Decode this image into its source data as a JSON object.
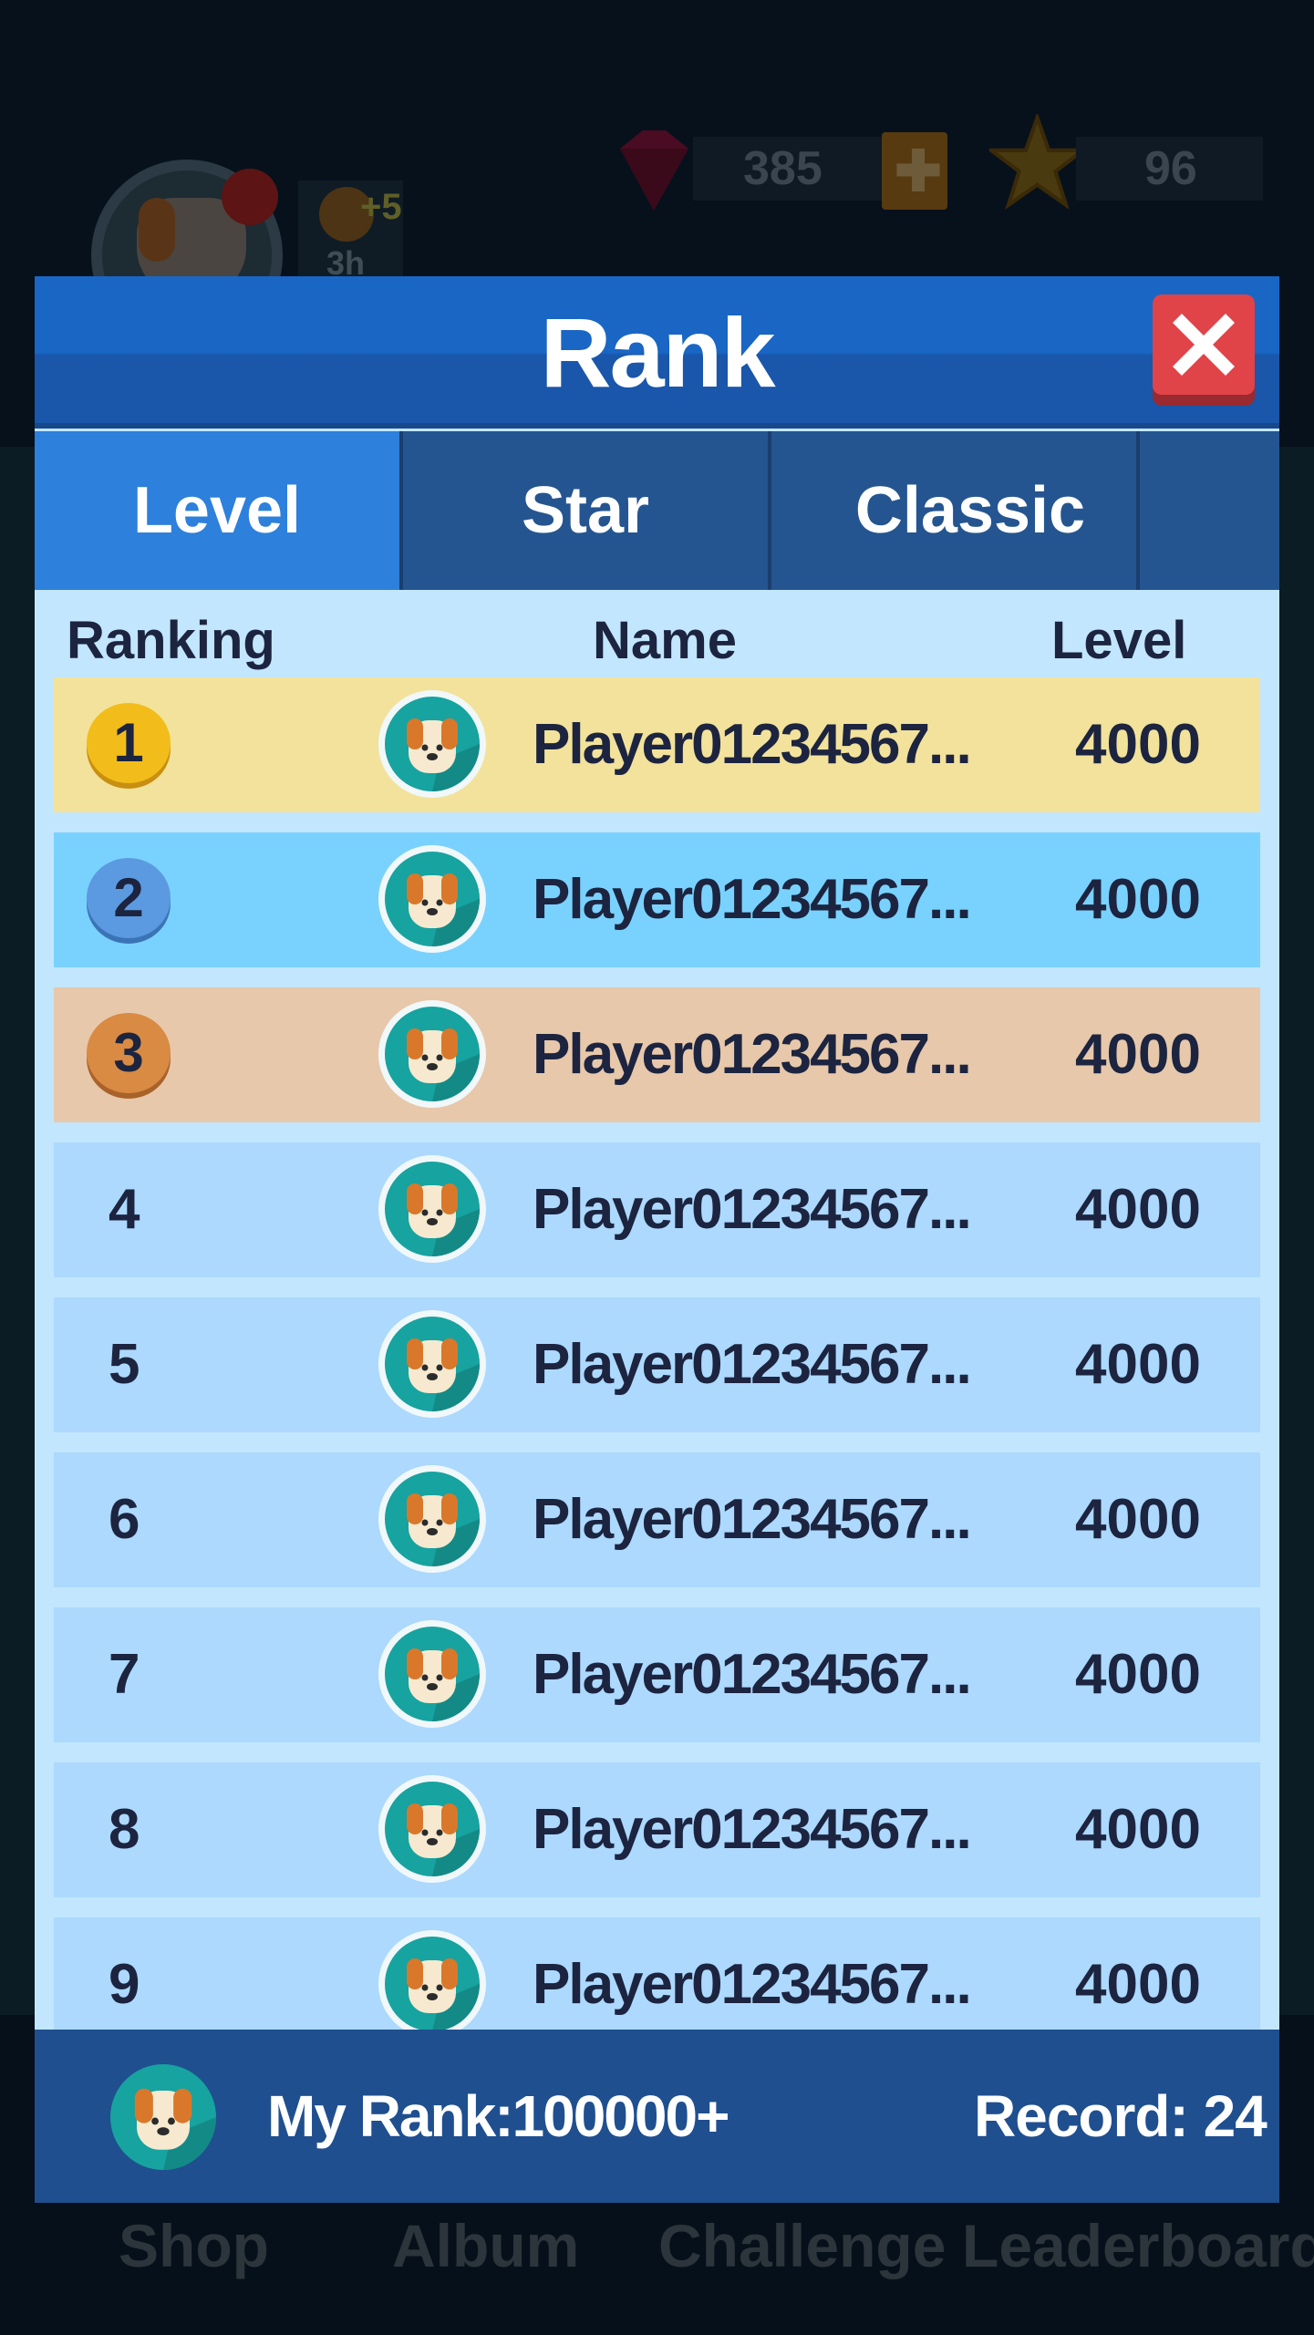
{
  "background": {
    "gems": "385",
    "stars": "96",
    "bonus_plus": "+5",
    "bonus_time": "3h",
    "nav": [
      "Shop",
      "Album",
      "Challenge",
      "Leaderboard"
    ]
  },
  "modal": {
    "title": "Rank",
    "close_icon": "close-x-icon",
    "tabs": [
      {
        "label": "Level",
        "active": true
      },
      {
        "label": "Star",
        "active": false
      },
      {
        "label": "Classic",
        "active": false
      }
    ],
    "columns": {
      "ranking": "Ranking",
      "name": "Name",
      "level": "Level"
    },
    "rows": [
      {
        "rank": "1",
        "name": "Player01234567...",
        "level": "4000",
        "medal": "gold"
      },
      {
        "rank": "2",
        "name": "Player01234567...",
        "level": "4000",
        "medal": "silver"
      },
      {
        "rank": "3",
        "name": "Player01234567...",
        "level": "4000",
        "medal": "bronze"
      },
      {
        "rank": "4",
        "name": "Player01234567...",
        "level": "4000"
      },
      {
        "rank": "5",
        "name": "Player01234567...",
        "level": "4000"
      },
      {
        "rank": "6",
        "name": "Player01234567...",
        "level": "4000"
      },
      {
        "rank": "7",
        "name": "Player01234567...",
        "level": "4000"
      },
      {
        "rank": "8",
        "name": "Player01234567...",
        "level": "4000"
      },
      {
        "rank": "9",
        "name": "Player01234567...",
        "level": "4000"
      }
    ],
    "footer": {
      "my_rank": "My Rank:100000+",
      "record": "Record: 24"
    }
  },
  "colors": {
    "header": "#1a66c5",
    "active_tab": "#2d80db",
    "tab": "#245590",
    "list_bg": "#c2e6fd",
    "row": "#acd9fd",
    "gold_row": "#f2e29b",
    "silver_row": "#79d2fd",
    "bronze_row": "#e7c8ab",
    "close": "#e04348",
    "text": "#1c2440"
  }
}
